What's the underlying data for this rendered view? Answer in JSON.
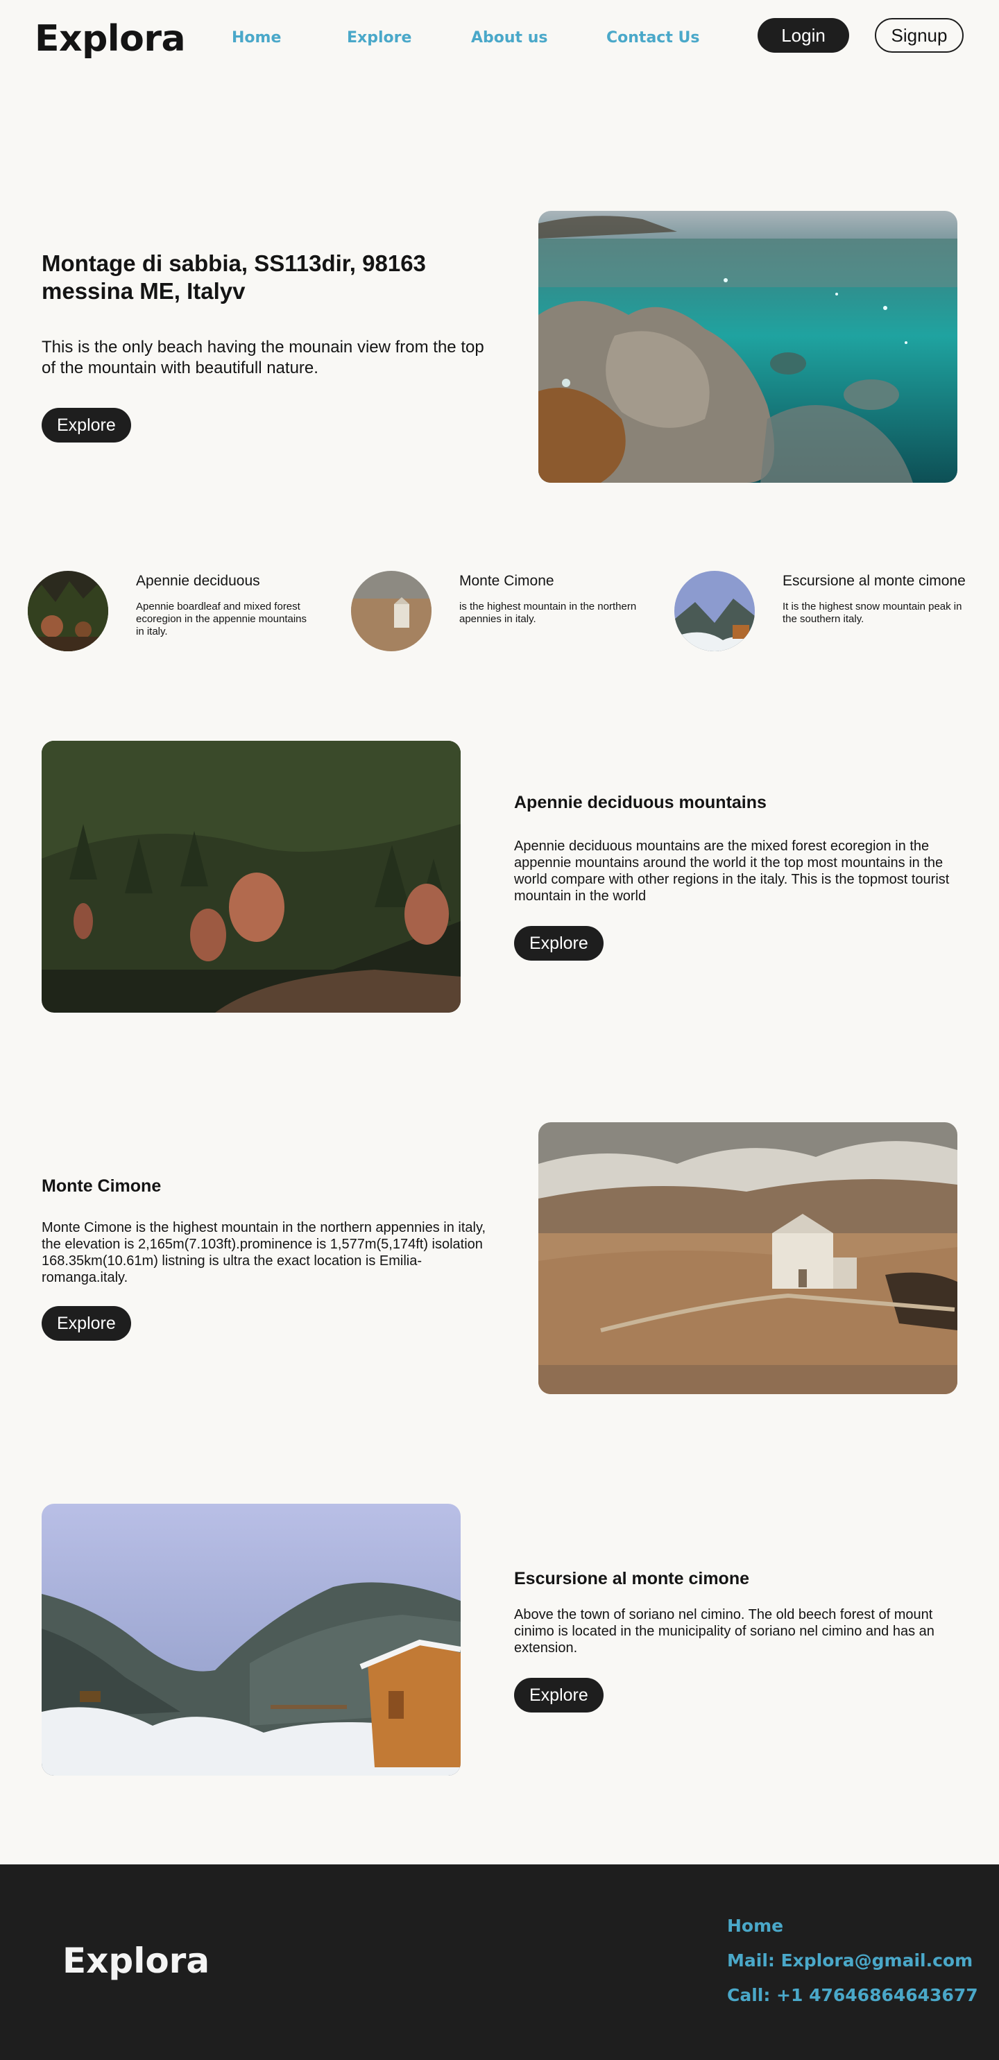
{
  "brand": "Explora",
  "nav": [
    "Home",
    "Explore",
    "About us",
    "Contact Us"
  ],
  "auth": {
    "login": "Login",
    "signup": "Signup"
  },
  "hero": {
    "title": "Montage di sabbia, SS113dir, 98163 messina ME, Italyv",
    "text": "This is the only beach having the mounain view from the top of the mountain with beautifull nature.",
    "button": "Explore"
  },
  "mini_cards": [
    {
      "title": "Apennie deciduous",
      "text": "Apennie boardleaf and mixed forest ecoregion in the appennie mountains in italy."
    },
    {
      "title": "Monte Cimone",
      "text": "is the highest mountain in the northern apennies in italy."
    },
    {
      "title": "Escursione al monte cimone",
      "text": "It is the highest snow mountain peak in the southern italy."
    }
  ],
  "sections": [
    {
      "title": "Apennie deciduous mountains",
      "text": "Apennie deciduous mountains are the mixed forest ecoregion in the appennie mountains around the world it the top most mountains in the world compare with other regions in the italy. This is the topmost tourist mountain in the world",
      "button": "Explore"
    },
    {
      "title": "Monte Cimone",
      "text": "Monte Cimone is the highest mountain in the northern appennies in italy, the elevation is 2,165m(7.103ft).prominence is 1,577m(5,174ft) isolation 168.35km(10.61m) listning is ultra the exact location is Emilia-romanga.italy.",
      "button": "Explore"
    },
    {
      "title": "Escursione al monte cimone",
      "text": "Above the town of soriano nel cimino. The old beech forest of mount cinimo is located in the municipality of soriano nel cimino and has an extension.",
      "button": "Explore"
    }
  ],
  "footer": {
    "brand": "Explora",
    "links": [
      "Home",
      "Mail: Explora@gmail.com",
      "Call: +1 47646864643677"
    ]
  },
  "colors": {
    "background": "#f9f8f5",
    "dark": "#1e1e1e",
    "accent": "#4aa8c9"
  }
}
